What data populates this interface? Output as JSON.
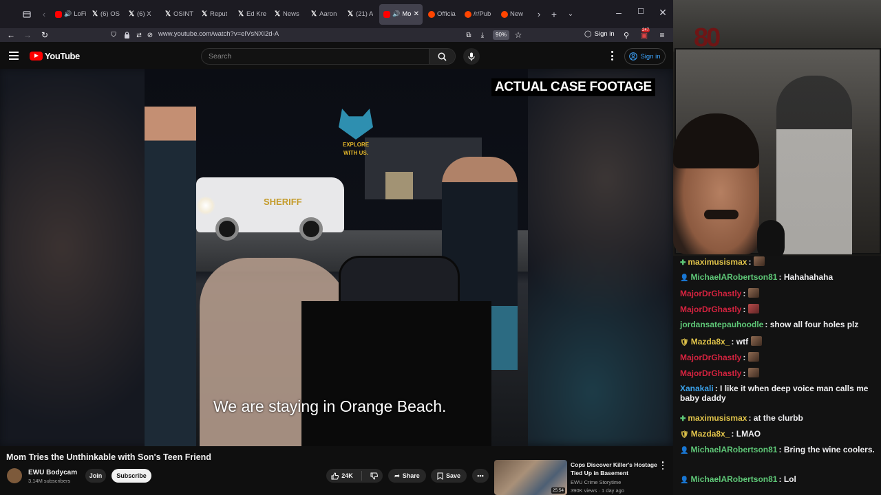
{
  "browser": {
    "tabs": [
      {
        "label": "LoFi In",
        "icon": "youtube"
      },
      {
        "label": "(6) OS",
        "icon": "x"
      },
      {
        "label": "(6) X",
        "icon": "x"
      },
      {
        "label": "OSINT",
        "icon": "x"
      },
      {
        "label": "Reput",
        "icon": "x"
      },
      {
        "label": "Ed Kre",
        "icon": "x"
      },
      {
        "label": "News",
        "icon": "x"
      },
      {
        "label": "Aaron",
        "icon": "x"
      },
      {
        "label": "(21) A",
        "icon": "x"
      },
      {
        "label": "Mo",
        "icon": "youtube",
        "active": true
      },
      {
        "label": "Officia",
        "icon": "reddit"
      },
      {
        "label": "/r/Pub",
        "icon": "reddit"
      },
      {
        "label": "New",
        "icon": "reddit"
      }
    ],
    "url": "www.youtube.com/watch?v=eIVsNXI2d-A",
    "zoom": "90%",
    "sign_in": "Sign in",
    "ext_badge": "247"
  },
  "youtube": {
    "logo_text": "YouTube",
    "search_placeholder": "Search",
    "sign_in": "Sign in"
  },
  "video": {
    "overlay_label": "ACTUAL CASE FOOTAGE",
    "subtitle": "We are staying in Orange Beach.",
    "watermark_line1": "EXPLORE",
    "watermark_line2": "WITH US.",
    "truck_text": "SHERIFF",
    "title": "Mom Tries the Unthinkable with Son's Teen Friend",
    "channel": "EWU Bodycam",
    "subscribers": "3.14M subscribers",
    "join": "Join",
    "subscribe": "Subscribe",
    "likes": "24K",
    "share": "Share",
    "save": "Save"
  },
  "recommended": {
    "title": "Cops Discover Killer's Hostage Tied Up in Basement",
    "channel": "EWU Crime Storytime",
    "meta": "390K views · 1 day ago",
    "duration": "25:54"
  },
  "stream": {
    "logo": "80"
  },
  "chat": [
    {
      "badge": "plus",
      "user": "maximusismax",
      "color": "#e0c34a",
      "text": ":",
      "emote": "face"
    },
    {
      "badge": "user-mod",
      "user": "MichaelARobertson81",
      "color": "#5ec777",
      "text": ": Hahahahaha"
    },
    {
      "badge": "",
      "user": "MajorDrGhastly",
      "color": "#d4233f",
      "text": ":",
      "emote": "face"
    },
    {
      "badge": "",
      "user": "MajorDrGhastly",
      "color": "#d4233f",
      "text": ":",
      "emote": "red"
    },
    {
      "badge": "",
      "user": "jordansatepauhoodle",
      "color": "#5ec777",
      "text": ": show all four holes plz"
    },
    {
      "badge": "shield",
      "user": "Mazda8x_",
      "color": "#e0c34a",
      "text": ": wtf",
      "emote": "face"
    },
    {
      "badge": "",
      "user": "MajorDrGhastly",
      "color": "#d4233f",
      "text": ":",
      "emote": "face"
    },
    {
      "badge": "",
      "user": "MajorDrGhastly",
      "color": "#d4233f",
      "text": ":",
      "emote": "face"
    },
    {
      "badge": "",
      "user": "Xanakali",
      "color": "#3aa0e8",
      "text": ": I like it when deep voice man calls me baby daddy"
    },
    {
      "badge": "plus",
      "user": "maximusismax",
      "color": "#e0c34a",
      "text": ": at the clurbb"
    },
    {
      "badge": "shield",
      "user": "Mazda8x_",
      "color": "#e0c34a",
      "text": ": LMAO"
    },
    {
      "badge": "user-mod",
      "user": "MichaelARobertson81",
      "color": "#5ec777",
      "text": ": Bring the wine coolers."
    },
    {
      "badge": "user-mod",
      "user": "MichaelARobertson81",
      "color": "#5ec777",
      "text": ": Lol"
    }
  ]
}
